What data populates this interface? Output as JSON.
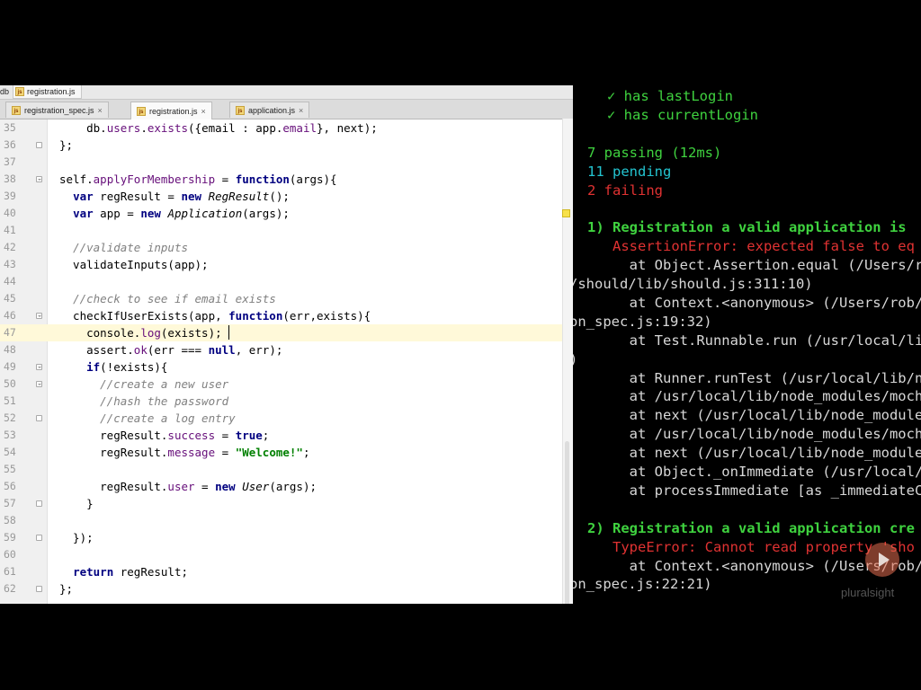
{
  "breadcrumb": {
    "root": "db",
    "file": "registration.js"
  },
  "tabs": [
    {
      "label": "registration_spec.js",
      "active": false
    },
    {
      "label": "registration.js",
      "active": true
    },
    {
      "label": "application.js",
      "active": false
    }
  ],
  "code_lines": [
    {
      "num": "35",
      "text": "    db.users.exists({email : app.email}, next);"
    },
    {
      "num": "36",
      "text": "};"
    },
    {
      "num": "37",
      "text": ""
    },
    {
      "num": "38",
      "text": "self.applyForMembership = function(args){"
    },
    {
      "num": "39",
      "text": "  var regResult = new RegResult();"
    },
    {
      "num": "40",
      "text": "  var app = new Application(args);"
    },
    {
      "num": "41",
      "text": ""
    },
    {
      "num": "42",
      "text": "  //validate inputs"
    },
    {
      "num": "43",
      "text": "  validateInputs(app);"
    },
    {
      "num": "44",
      "text": ""
    },
    {
      "num": "45",
      "text": "  //check to see if email exists"
    },
    {
      "num": "46",
      "text": "  checkIfUserExists(app, function(err,exists){"
    },
    {
      "num": "47",
      "text": "    console.log(exists);"
    },
    {
      "num": "48",
      "text": "    assert.ok(err === null, err);"
    },
    {
      "num": "49",
      "text": "    if(!exists){"
    },
    {
      "num": "50",
      "text": "      //create a new user"
    },
    {
      "num": "51",
      "text": "      //hash the password"
    },
    {
      "num": "52",
      "text": "      //create a log entry"
    },
    {
      "num": "53",
      "text": "      regResult.success = true;"
    },
    {
      "num": "54",
      "text": "      regResult.message = \"Welcome!\";"
    },
    {
      "num": "55",
      "text": ""
    },
    {
      "num": "56",
      "text": "      regResult.user = new User(args);"
    },
    {
      "num": "57",
      "text": "    }"
    },
    {
      "num": "58",
      "text": ""
    },
    {
      "num": "59",
      "text": "  });"
    },
    {
      "num": "60",
      "text": ""
    },
    {
      "num": "61",
      "text": "  return regResult;"
    },
    {
      "num": "62",
      "text": "};"
    }
  ],
  "terminal": {
    "lines": [
      {
        "text": "  ✓ has lastLogin",
        "style": "check"
      },
      {
        "text": "  ✓ has currentLogin",
        "style": "check"
      },
      {
        "text": "",
        "style": "plain"
      },
      {
        "text": "7 passing (12ms)",
        "style": "passing"
      },
      {
        "text": "11 pending",
        "style": "pending"
      },
      {
        "text": "2 failing",
        "style": "failing"
      },
      {
        "text": "",
        "style": "plain"
      },
      {
        "text": "1) Registration a valid application is",
        "style": "title"
      },
      {
        "text": "   AssertionError: expected false to eq",
        "style": "error"
      },
      {
        "text": "     at Object.Assertion.equal (/Users/r",
        "style": "plain"
      },
      {
        "text": "/should/lib/should.js:311:10)",
        "style": "plain_left"
      },
      {
        "text": "     at Context.<anonymous> (/Users/rob/",
        "style": "plain"
      },
      {
        "text": "on_spec.js:19:32)",
        "style": "plain_left"
      },
      {
        "text": "     at Test.Runnable.run (/usr/local/li",
        "style": "plain"
      },
      {
        "text": ")",
        "style": "plain_left"
      },
      {
        "text": "     at Runner.runTest (/usr/local/lib/n",
        "style": "plain"
      },
      {
        "text": "     at /usr/local/lib/node_modules/moch",
        "style": "plain"
      },
      {
        "text": "     at next (/usr/local/lib/node_module",
        "style": "plain"
      },
      {
        "text": "     at /usr/local/lib/node_modules/moch",
        "style": "plain"
      },
      {
        "text": "     at next (/usr/local/lib/node_module",
        "style": "plain"
      },
      {
        "text": "     at Object._onImmediate (/usr/local/",
        "style": "plain"
      },
      {
        "text": "     at processImmediate [as _immediateC",
        "style": "plain"
      },
      {
        "text": "",
        "style": "plain"
      },
      {
        "text": "2) Registration a valid application cre",
        "style": "title"
      },
      {
        "text": "   TypeError: Cannot read property 'sho",
        "style": "error"
      },
      {
        "text": "     at Context.<anonymous> (/Users/rob/",
        "style": "plain"
      },
      {
        "text": "on_spec.js:22:21)",
        "style": "plain_left"
      }
    ]
  },
  "watermark": "pluralsight",
  "colors": {
    "editor_bg": "#ffffff",
    "current_line": "#fff9d9",
    "keyword": "#000080",
    "string": "#008000",
    "comment": "#808080",
    "property": "#660e7a",
    "terminal_green": "#3fd23f",
    "terminal_cyan": "#23c4d0",
    "terminal_red": "#e03232"
  }
}
